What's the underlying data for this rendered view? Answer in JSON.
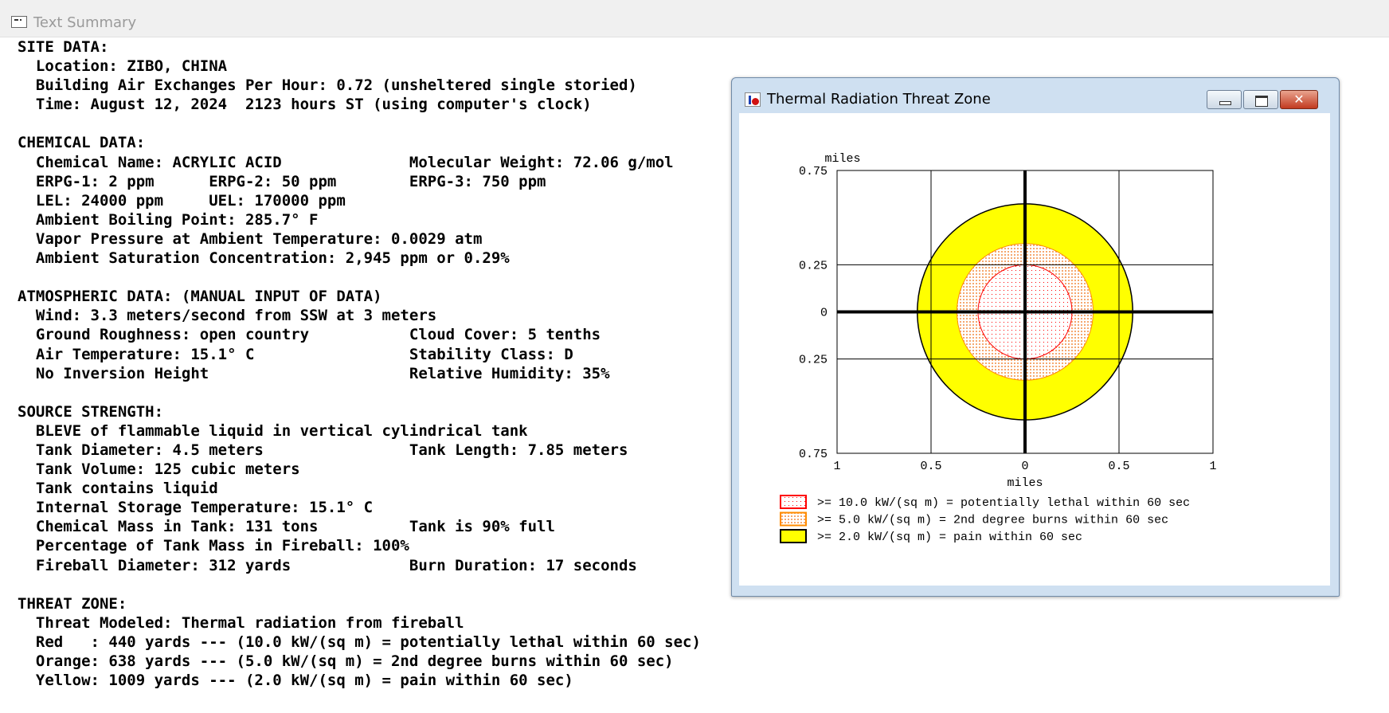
{
  "main_window": {
    "title": "Text Summary"
  },
  "summary_lines": [
    "SITE DATA:",
    "  Location: ZIBO, CHINA",
    "  Building Air Exchanges Per Hour: 0.72 (unsheltered single storied)",
    "  Time: August 12, 2024  2123 hours ST (using computer's clock)",
    "",
    "CHEMICAL DATA:",
    "  Chemical Name: ACRYLIC ACID              Molecular Weight: 72.06 g/mol",
    "  ERPG-1: 2 ppm      ERPG-2: 50 ppm        ERPG-3: 750 ppm",
    "  LEL: 24000 ppm     UEL: 170000 ppm",
    "  Ambient Boiling Point: 285.7° F",
    "  Vapor Pressure at Ambient Temperature: 0.0029 atm",
    "  Ambient Saturation Concentration: 2,945 ppm or 0.29%",
    "",
    "ATMOSPHERIC DATA: (MANUAL INPUT OF DATA)",
    "  Wind: 3.3 meters/second from SSW at 3 meters",
    "  Ground Roughness: open country           Cloud Cover: 5 tenths",
    "  Air Temperature: 15.1° C                 Stability Class: D",
    "  No Inversion Height                      Relative Humidity: 35%",
    "",
    "SOURCE STRENGTH:",
    "  BLEVE of flammable liquid in vertical cylindrical tank",
    "  Tank Diameter: 4.5 meters                Tank Length: 7.85 meters",
    "  Tank Volume: 125 cubic meters",
    "  Tank contains liquid",
    "  Internal Storage Temperature: 15.1° C",
    "  Chemical Mass in Tank: 131 tons          Tank is 90% full",
    "  Percentage of Tank Mass in Fireball: 100%",
    "  Fireball Diameter: 312 yards             Burn Duration: 17 seconds",
    "",
    "THREAT ZONE:",
    "  Threat Modeled: Thermal radiation from fireball",
    "  Red   : 440 yards --- (10.0 kW/(sq m) = potentially lethal within 60 sec)",
    "  Orange: 638 yards --- (5.0 kW/(sq m) = 2nd degree burns within 60 sec)",
    "  Yellow: 1009 yards --- (2.0 kW/(sq m) = pain within 60 sec)"
  ],
  "threat_window": {
    "title": "Thermal Radiation Threat Zone",
    "close_glyph": "✕"
  },
  "chart_data": {
    "type": "threat-zone",
    "x_unit_label": "miles",
    "y_unit_label": "miles",
    "xlim": [
      -1,
      1
    ],
    "ylim": [
      -0.75,
      0.75
    ],
    "x_ticks": [
      {
        "value": -1,
        "label": "1"
      },
      {
        "value": -0.5,
        "label": "0.5"
      },
      {
        "value": 0,
        "label": "0"
      },
      {
        "value": 0.5,
        "label": "0.5"
      },
      {
        "value": 1,
        "label": "1"
      }
    ],
    "y_ticks": [
      {
        "value": 0.75,
        "label": "0.75"
      },
      {
        "value": 0.25,
        "label": "0.25"
      },
      {
        "value": 0,
        "label": "0"
      },
      {
        "value": -0.25,
        "label": "0.25"
      },
      {
        "value": -0.75,
        "label": "0.75"
      }
    ],
    "grid": true,
    "zones": [
      {
        "name": "yellow",
        "radius_yards": 1009,
        "radius_miles": 0.573,
        "color": "#ffff00",
        "pattern": "solid",
        "legend": ">= 2.0 kW/(sq m) = pain within 60 sec"
      },
      {
        "name": "orange",
        "radius_yards": 638,
        "radius_miles": 0.3625,
        "color": "#ff8c00",
        "pattern": "dots",
        "legend": ">= 5.0 kW/(sq m) = 2nd degree burns within 60 sec"
      },
      {
        "name": "red",
        "radius_yards": 440,
        "radius_miles": 0.25,
        "color": "#ff0000",
        "pattern": "dots",
        "legend": ">= 10.0 kW/(sq m) = potentially lethal within 60 sec"
      }
    ],
    "legend_order": [
      "red",
      "orange",
      "yellow"
    ],
    "legend_position": "bottom"
  }
}
